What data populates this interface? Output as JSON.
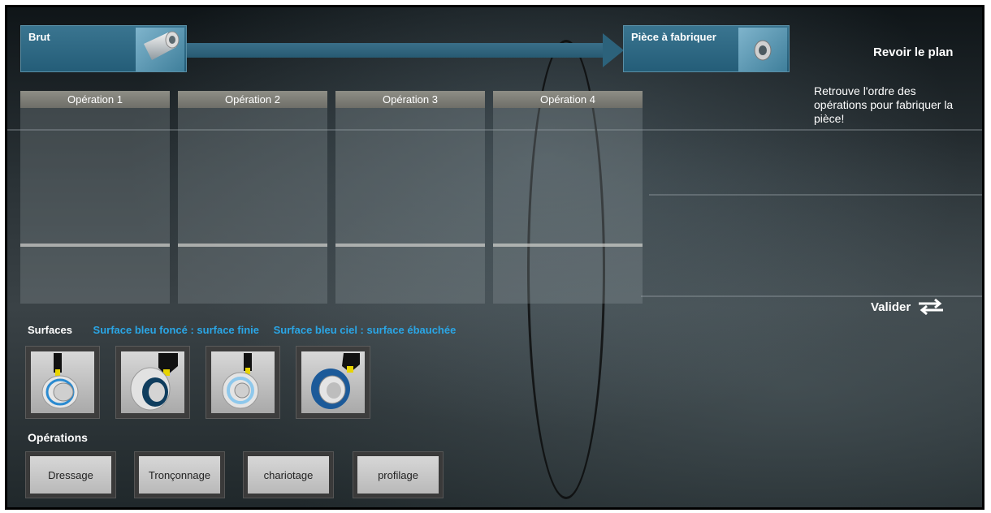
{
  "header": {
    "stock_label": "Brut",
    "part_label": "Pièce à fabriquer",
    "review_label": "Revoir le plan",
    "instructions": "Retrouve  l'ordre des opérations pour fabriquer la pièce!"
  },
  "operations_slots": [
    {
      "label": "Opération 1"
    },
    {
      "label": "Opération 2"
    },
    {
      "label": "Opération 3"
    },
    {
      "label": "Opération 4"
    }
  ],
  "validate_label": "Valider",
  "surfaces": {
    "title": "Surfaces",
    "legend_dark": "Surface bleu foncé : surface finie",
    "legend_light": "Surface bleu ciel : surface ébauchée",
    "tiles": [
      {
        "icon": "facing-tool-icon"
      },
      {
        "icon": "parting-tool-icon"
      },
      {
        "icon": "turning-tool-icon"
      },
      {
        "icon": "profiling-tool-icon"
      }
    ]
  },
  "operations": {
    "title": "Opérations",
    "buttons": [
      {
        "label": "Dressage"
      },
      {
        "label": "Tronçonnage"
      },
      {
        "label": "chariotage"
      },
      {
        "label": "profilage"
      }
    ]
  },
  "colors": {
    "panel_blue": "#2c627b",
    "legend_blue": "#2aa6e6",
    "dark_blue_surface": "#1c4f8f",
    "light_blue_surface": "#7ec4ea"
  }
}
